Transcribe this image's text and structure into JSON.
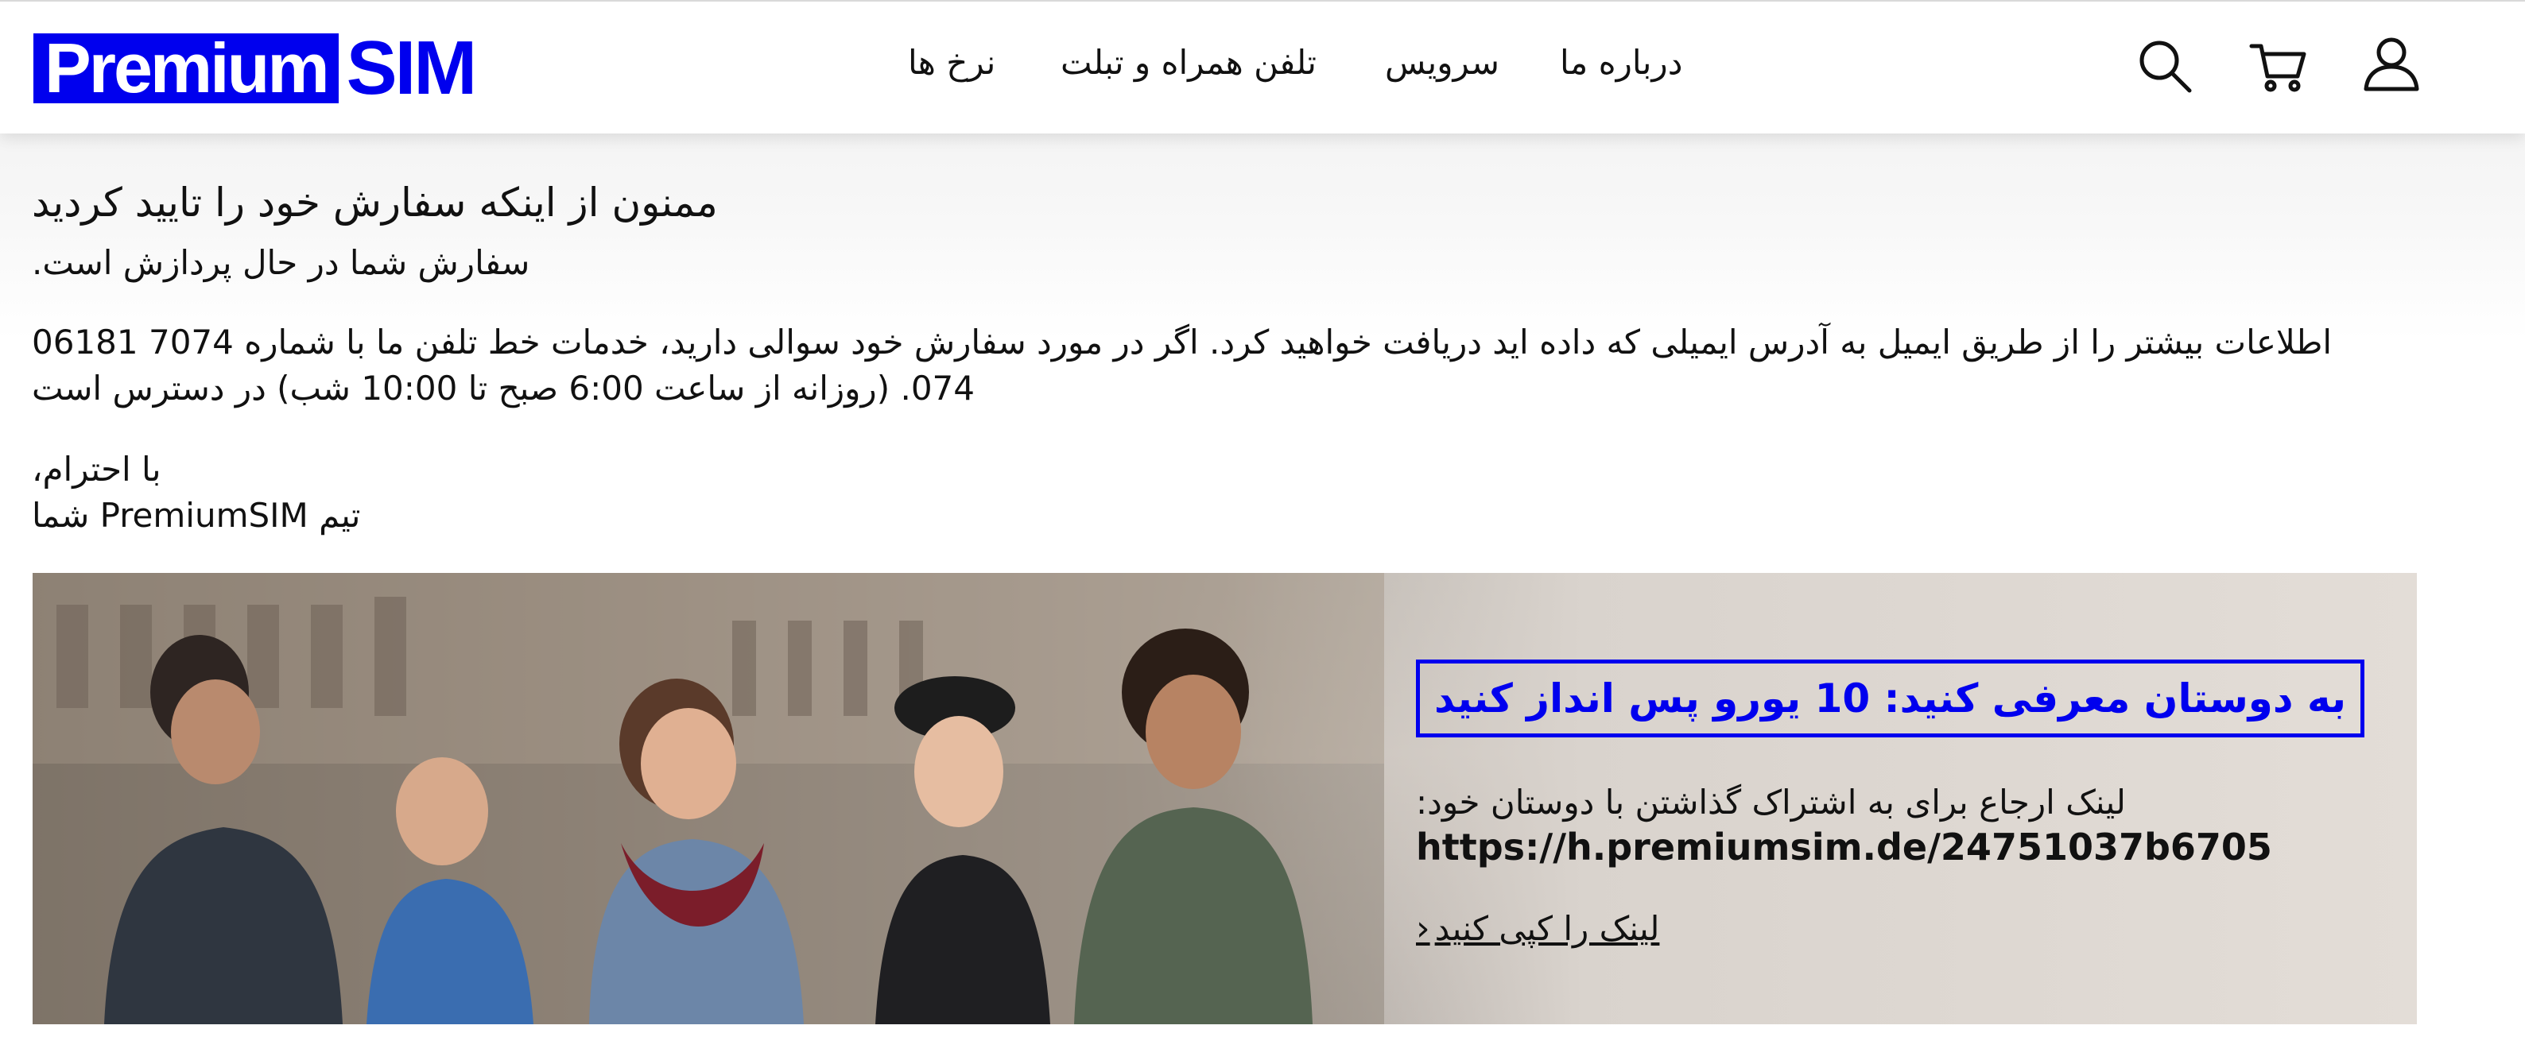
{
  "header": {
    "logo_left": "Premium",
    "logo_right": "SIM",
    "nav": {
      "about": "درباره ما",
      "service": "سرویس",
      "phones": "تلفن همراه و تبلت",
      "rates": "نرخ ها"
    },
    "icons": [
      "search-icon",
      "cart-icon",
      "user-icon"
    ]
  },
  "main": {
    "title": "ممنون از اینکه سفارش خود را تایید کردید",
    "subtitle": "سفارش شما در حال پردازش است.",
    "info_line1": "اطلاعات بیشتر را از طریق ایمیل به آدرس ایمیلی که داده اید دریافت خواهید کرد. اگر در مورد سفارش خود سوالی دارید، خدمات خط تلفن ما با شماره 7074 06181",
    "info_line2": "074. (روزانه از ساعت 6:00 صبح تا 10:00 شب) در دسترس است",
    "regards": "با احترام،",
    "team": "تیم PremiumSIM شما"
  },
  "banner": {
    "promo_title": "به دوستان معرفی کنید: 10 یورو پس انداز کنید",
    "referral_label": "لینک ارجاع برای به اشتراک گذاشتن با دوستان خود:",
    "referral_link": "https://h.premiumsim.de/24751037b6705",
    "copy_label": "لینک را کپی کنید"
  },
  "colors": {
    "brand": "#0000ee",
    "text": "#111111"
  }
}
